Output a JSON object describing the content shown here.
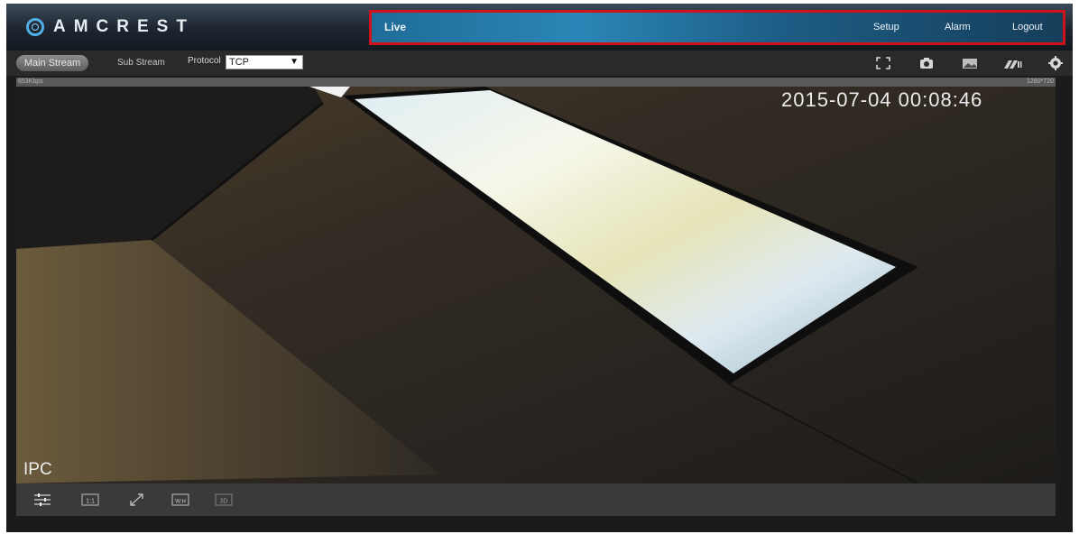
{
  "header": {
    "brand": "AMCREST",
    "nav": {
      "live": "Live",
      "setup": "Setup",
      "alarm": "Alarm",
      "logout": "Logout"
    },
    "highlight_color": "#d1121b"
  },
  "toolbar": {
    "main_stream": "Main Stream",
    "sub_stream": "Sub Stream",
    "protocol_label": "Protocol",
    "protocol_value": "TCP",
    "icons": [
      "fullscreen-icon",
      "snapshot-icon",
      "image-icon",
      "record-icon",
      "settings-icon"
    ]
  },
  "status": {
    "bitrate": "653Kbps",
    "resolution": "1280*720"
  },
  "video": {
    "timestamp": "2015-07-04 00:08:46",
    "camera_name": "IPC"
  },
  "bottombar": {
    "icons": [
      "image-adjust-icon",
      "original-size-icon",
      "expand-icon",
      "wh-ratio-icon",
      "zoom-icon"
    ],
    "labels": {
      "original_size": "1:1",
      "wh_ratio": "W:H",
      "zoom": "3D"
    }
  }
}
